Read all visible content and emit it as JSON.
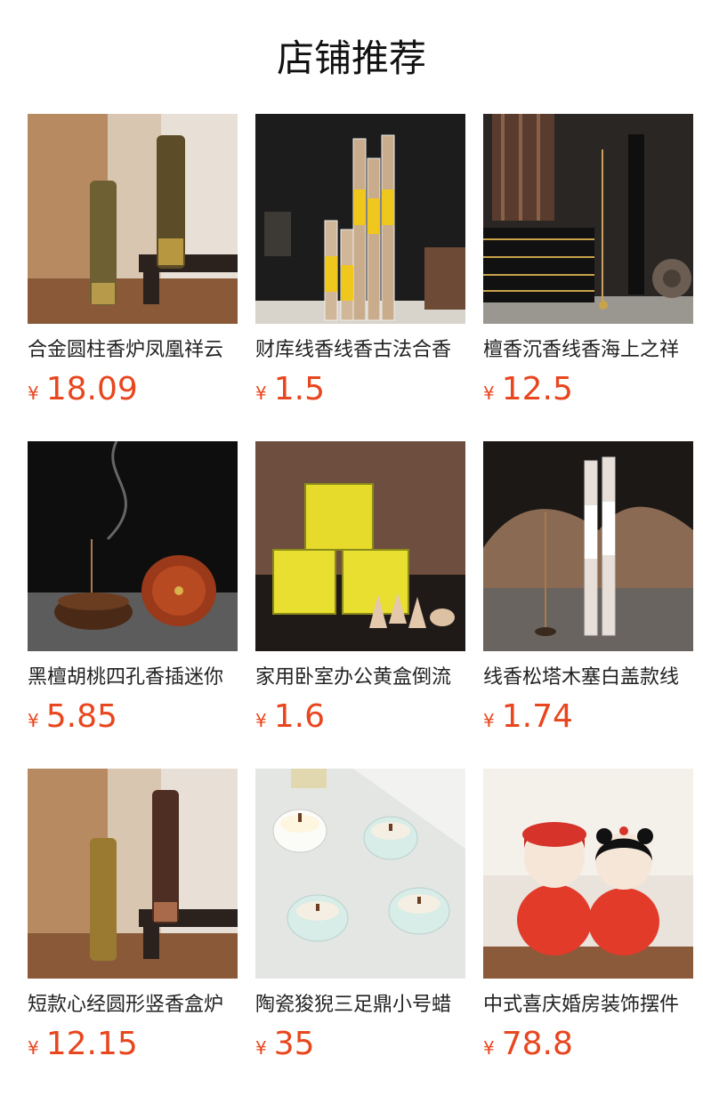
{
  "header": {
    "title": "店铺推荐"
  },
  "currency": "¥",
  "accent": "#e8461e",
  "products": [
    {
      "name": "合金圆柱香炉凤凰祥云",
      "price": "18.09",
      "image_icon": "brass-cylinder-incense-holder-image"
    },
    {
      "name": "财库线香线香古法合香",
      "price": "1.5",
      "image_icon": "incense-stick-tubes-image"
    },
    {
      "name": "檀香沉香线香海上之祥",
      "price": "12.5",
      "image_icon": "black-incense-box-image"
    },
    {
      "name": "黑檀胡桃四孔香插迷你",
      "price": "5.85",
      "image_icon": "wooden-incense-burner-image"
    },
    {
      "name": "家用卧室办公黄盒倒流",
      "price": "1.6",
      "image_icon": "yellow-box-incense-cones-image"
    },
    {
      "name": "线香松塔木塞白盖款线",
      "price": "1.74",
      "image_icon": "pine-incense-tubes-image"
    },
    {
      "name": "短款心经圆形竖香盒炉",
      "price": "12.15",
      "image_icon": "short-cylinder-incense-box-image"
    },
    {
      "name": "陶瓷狻猊三足鼎小号蜡",
      "price": "35",
      "image_icon": "ceramic-candle-cups-image"
    },
    {
      "name": "中式喜庆婚房装饰摆件",
      "price": "78.8",
      "image_icon": "wedding-couple-figurine-image"
    }
  ]
}
